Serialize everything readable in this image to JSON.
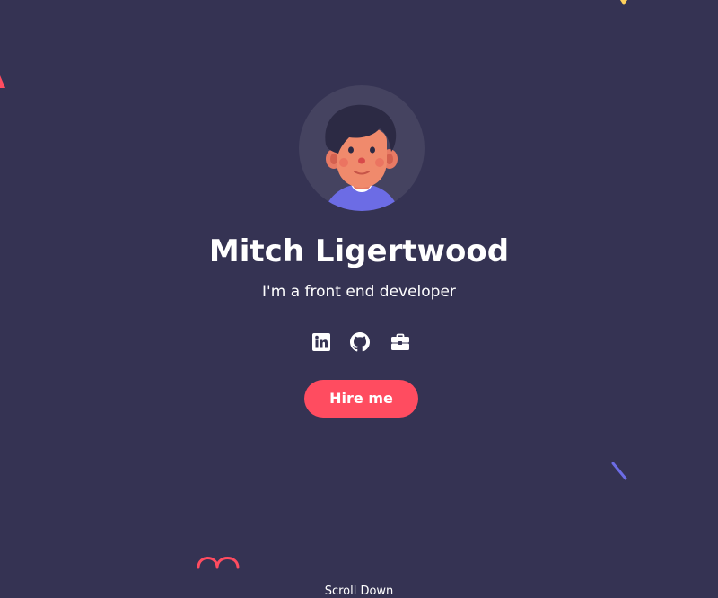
{
  "hero": {
    "name": "Mitch Ligertwood",
    "tagline": "I'm a front end developer",
    "cta_label": "Hire me",
    "scroll_label": "Scroll Down"
  },
  "social": {
    "items": [
      {
        "name": "linkedin",
        "icon": "linkedin-icon"
      },
      {
        "name": "github",
        "icon": "github-icon"
      },
      {
        "name": "portfolio",
        "icon": "briefcase-icon"
      }
    ]
  },
  "colors": {
    "background": "#353353",
    "accent": "#FF4C60",
    "avatar_bg": "#454360",
    "deco_blue": "#6C6CE5",
    "deco_yellow": "#FFD15C",
    "text": "#FFFFFF"
  }
}
